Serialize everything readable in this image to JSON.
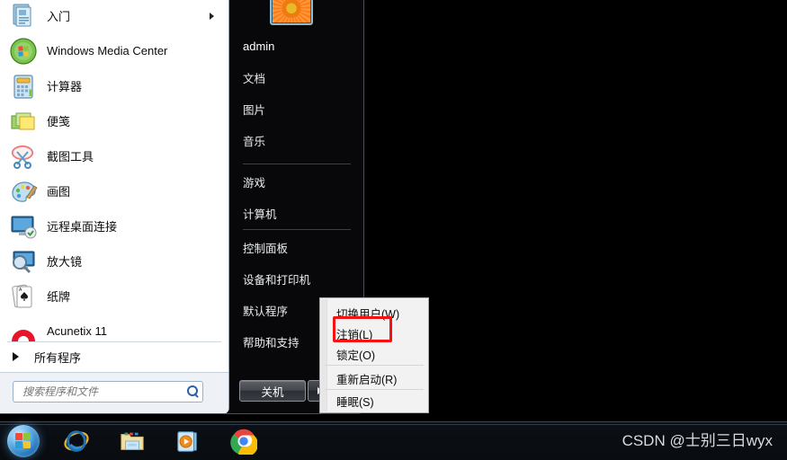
{
  "desktop": {
    "background_color": "#000000"
  },
  "start_menu": {
    "left_panel": {
      "programs": [
        {
          "label": "入门",
          "icon": "getting-started-icon",
          "has_submenu": true
        },
        {
          "label": "Windows Media Center",
          "icon": "windows-media-center-icon",
          "has_submenu": false
        },
        {
          "label": "计算器",
          "icon": "calculator-icon",
          "has_submenu": false
        },
        {
          "label": "便笺",
          "icon": "sticky-notes-icon",
          "has_submenu": false
        },
        {
          "label": "截图工具",
          "icon": "snipping-tool-icon",
          "has_submenu": false
        },
        {
          "label": "画图",
          "icon": "paint-icon",
          "has_submenu": false
        },
        {
          "label": "远程桌面连接",
          "icon": "remote-desktop-icon",
          "has_submenu": false
        },
        {
          "label": "放大镜",
          "icon": "magnifier-icon",
          "has_submenu": false
        },
        {
          "label": "纸牌",
          "icon": "solitaire-icon",
          "has_submenu": false
        },
        {
          "label": "Acunetix 11",
          "icon": "acunetix-icon",
          "has_submenu": false
        }
      ],
      "all_programs": {
        "label": "所有程序",
        "icon": "right-triangle-icon"
      },
      "search": {
        "placeholder": "搜索程序和文件",
        "value": "",
        "icon": "search-icon"
      }
    },
    "right_panel": {
      "avatar": "user-avatar-flower",
      "user_name": "admin",
      "groups": [
        [
          "文档",
          "图片",
          "音乐"
        ],
        [
          "游戏",
          "计算机"
        ],
        [
          "控制面板",
          "设备和打印机",
          "默认程序",
          "帮助和支持"
        ]
      ],
      "shutdown": {
        "label": "关机",
        "more_icon": "right-triangle-icon"
      }
    }
  },
  "shutdown_submenu": {
    "visible": true,
    "highlighted_item": "注销(L)",
    "highlight_color": "#f41212",
    "groups": [
      [
        "切换用户(W)",
        "注销(L)",
        "锁定(O)"
      ],
      [
        "重新启动(R)"
      ],
      [
        "睡眠(S)"
      ]
    ]
  },
  "taskbar": {
    "start_orb": "windows-start-orb-icon",
    "pinned": [
      {
        "name": "internet-explorer-icon",
        "label": "Internet Explorer"
      },
      {
        "name": "windows-explorer-icon",
        "label": "Windows 资源管理器"
      },
      {
        "name": "windows-media-player-icon",
        "label": "Windows Media Player"
      },
      {
        "name": "google-chrome-icon",
        "label": "Google Chrome"
      }
    ],
    "watermark": "CSDN @士别三日wyx"
  }
}
